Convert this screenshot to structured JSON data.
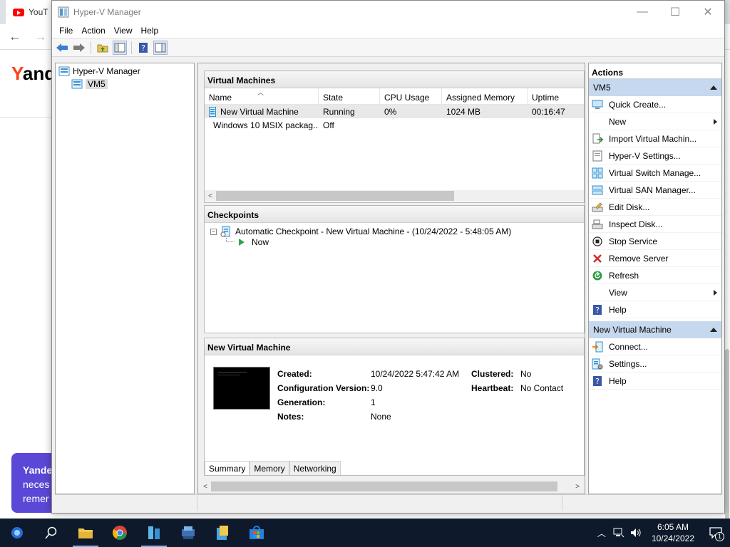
{
  "browser": {
    "tab_label": "YouT",
    "logo_y": "Y",
    "logo_rest": "and",
    "promo_lines": [
      "Yande",
      "neces",
      "remer"
    ]
  },
  "window": {
    "title": "Hyper-V Manager",
    "minimize": "—",
    "maximize": "☐",
    "close": "✕"
  },
  "menu": [
    "File",
    "Action",
    "View",
    "Help"
  ],
  "tree": {
    "root": "Hyper-V Manager",
    "child": "VM5"
  },
  "vms": {
    "title": "Virtual Machines",
    "columns": [
      "Name",
      "State",
      "CPU Usage",
      "Assigned Memory",
      "Uptime"
    ],
    "rows": [
      {
        "name": "New Virtual Machine",
        "state": "Running",
        "cpu": "0%",
        "memory": "1024 MB",
        "uptime": "00:16:47"
      },
      {
        "name": "Windows 10 MSIX packag...",
        "state": "Off",
        "cpu": "",
        "memory": "",
        "uptime": ""
      }
    ]
  },
  "checkpoints": {
    "title": "Checkpoints",
    "entry": "Automatic Checkpoint - New Virtual Machine - (10/24/2022 - 5:48:05 AM)",
    "now": "Now"
  },
  "details": {
    "title": "New Virtual Machine",
    "created_label": "Created:",
    "created": "10/24/2022 5:47:42 AM",
    "config_label": "Configuration Version:",
    "config": "9.0",
    "generation_label": "Generation:",
    "generation": "1",
    "notes_label": "Notes:",
    "notes": "None",
    "clustered_label": "Clustered:",
    "clustered": "No",
    "heartbeat_label": "Heartbeat:",
    "heartbeat": "No Contact",
    "tabs": [
      "Summary",
      "Memory",
      "Networking"
    ]
  },
  "actions": {
    "title": "Actions",
    "group1": "VM5",
    "group1_items": [
      "Quick Create...",
      "New",
      "Import Virtual Machin...",
      "Hyper-V Settings...",
      "Virtual Switch Manage...",
      "Virtual SAN Manager...",
      "Edit Disk...",
      "Inspect Disk...",
      "Stop Service",
      "Remove Server",
      "Refresh",
      "View",
      "Help"
    ],
    "group2": "New Virtual Machine",
    "group2_items": [
      "Connect...",
      "Settings...",
      "Help"
    ]
  },
  "taskbar": {
    "time": "6:05 AM",
    "date": "10/24/2022",
    "notification_count": "1"
  },
  "colors": {
    "action_group_bg": "#c6d8ee",
    "taskbar_bg": "#0e1a2b",
    "remove_red": "#d32f2f",
    "refresh_green": "#2e9e44"
  }
}
